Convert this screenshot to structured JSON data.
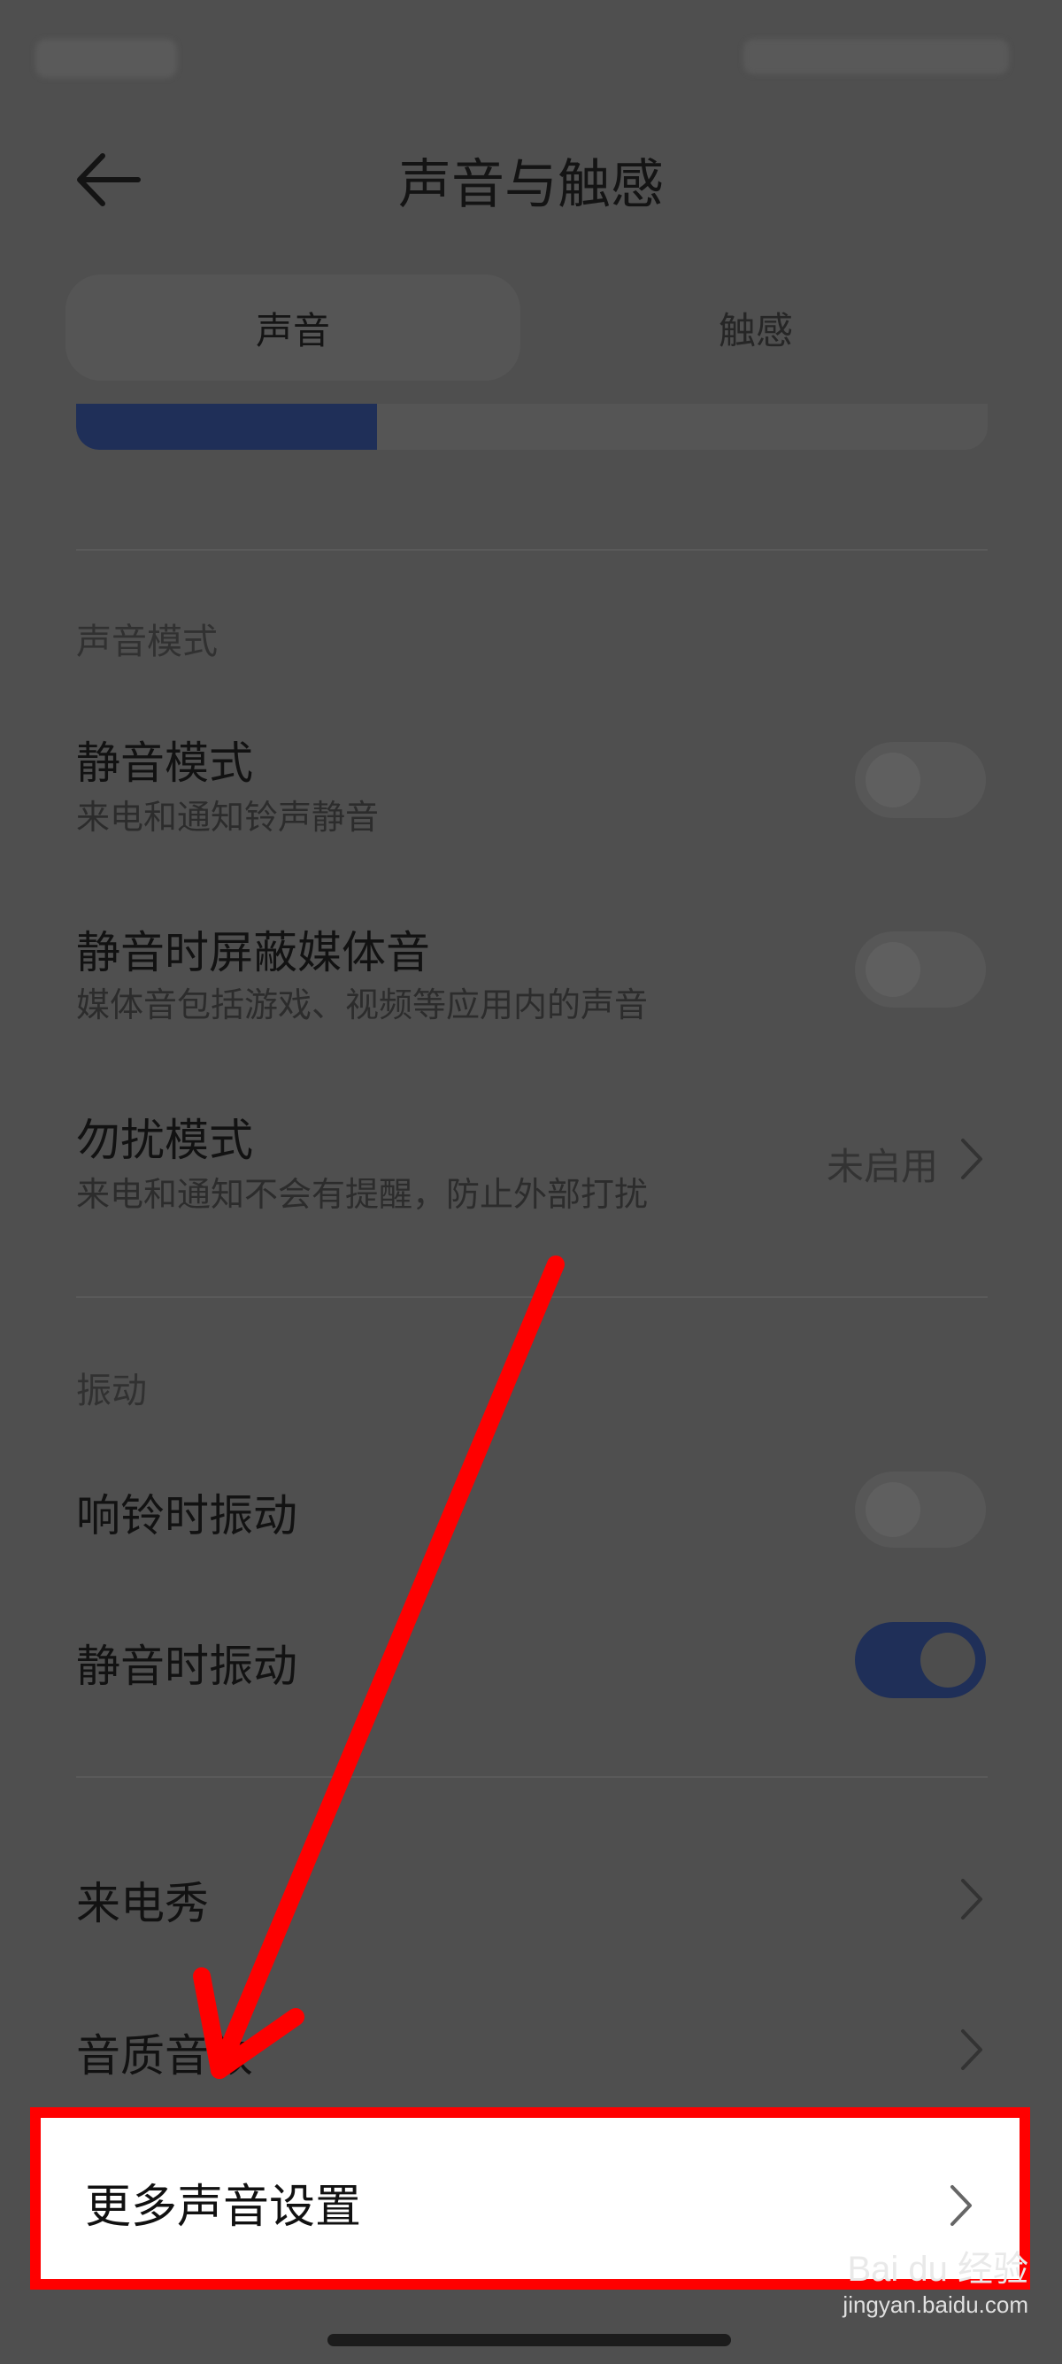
{
  "header": {
    "title": "声音与触感"
  },
  "tabs": [
    {
      "label": "声音",
      "active": true
    },
    {
      "label": "触感",
      "active": false
    }
  ],
  "volume": {
    "level": 0.33
  },
  "sections": {
    "sound_mode": {
      "title": "声音模式",
      "rows": [
        {
          "title": "静音模式",
          "subtitle": "来电和通知铃声静音",
          "toggle_on": false
        },
        {
          "title": "静音时屏蔽媒体音",
          "subtitle": "媒体音包括游戏、视频等应用内的声音",
          "toggle_on": false
        },
        {
          "title": "勿扰模式",
          "subtitle": "来电和通知不会有提醒，防止外部打扰",
          "value": "未启用"
        }
      ]
    },
    "vibration": {
      "title": "振动",
      "rows": [
        {
          "title": "响铃时振动",
          "toggle_on": false
        },
        {
          "title": "静音时振动",
          "toggle_on": true
        }
      ]
    },
    "more": {
      "rows": [
        {
          "title": "来电秀"
        },
        {
          "title": "音质音效"
        },
        {
          "title": "更多声音设置"
        }
      ]
    }
  },
  "colors": {
    "accent": "#1f2f58",
    "highlight": "#ff0000",
    "dim_background": "#4f4f4f"
  },
  "icons": {
    "back": "arrow-left",
    "chevron": "chevron-right"
  },
  "watermark": {
    "brand": "Bai du 经验",
    "url": "jingyan.baidu.com"
  }
}
